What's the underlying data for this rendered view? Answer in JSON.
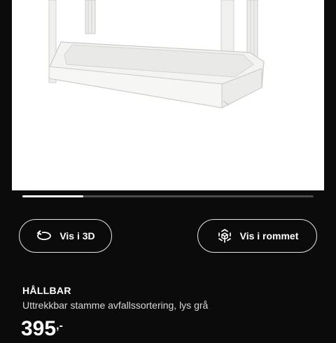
{
  "gallery": {
    "progress_fraction": 0.21
  },
  "actions": {
    "view_3d_label": "Vis i 3D",
    "view_3d_icon": "rotate-3d-icon",
    "view_room_label": "Vis i rommet",
    "view_room_icon": "ar-room-icon"
  },
  "product": {
    "name": "HÅLLBAR",
    "description": "Uttrekkbar stamme avfallssortering, lys grå",
    "price_main": "395",
    "price_suffix": ",-"
  },
  "colors": {
    "background": "#0b0b0b",
    "text": "#ffffff",
    "product_image_bg": "#ffffff",
    "progress_track": "#4a4a4a",
    "progress_fill": "#ffffff"
  }
}
